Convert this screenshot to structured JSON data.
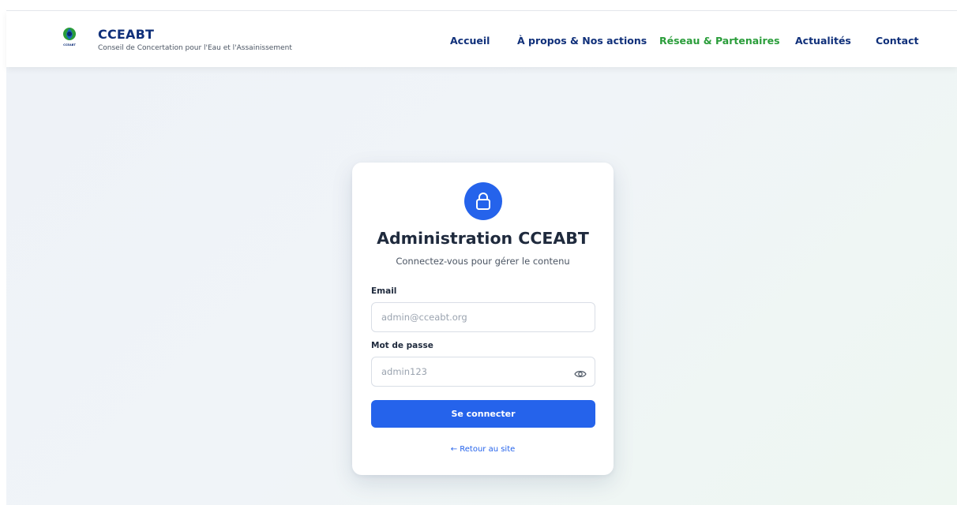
{
  "header": {
    "brand_name": "CCEABT",
    "brand_subtitle": "Conseil de Concertation pour l'Eau et l'Assainissement",
    "logo_caption": "CCEABT",
    "nav": [
      {
        "label": "Accueil",
        "active": false
      },
      {
        "label": "À propos & Nos actions",
        "active": false
      },
      {
        "label": "Réseau & Partenaires",
        "active": true
      },
      {
        "label": "Actualités",
        "active": false
      },
      {
        "label": "Contact",
        "active": false
      }
    ]
  },
  "login": {
    "icon": "lock-icon",
    "title": "Administration CCEABT",
    "subtitle": "Connectez-vous pour gérer le contenu",
    "email_label": "Email",
    "email_placeholder": "admin@cceabt.org",
    "password_label": "Mot de passe",
    "password_placeholder": "admin123",
    "submit_label": "Se connecter",
    "back_link": "← Retour au site"
  },
  "colors": {
    "brand_navy": "#10307a",
    "active_green": "#2a9d3a",
    "primary_blue": "#2563eb"
  }
}
